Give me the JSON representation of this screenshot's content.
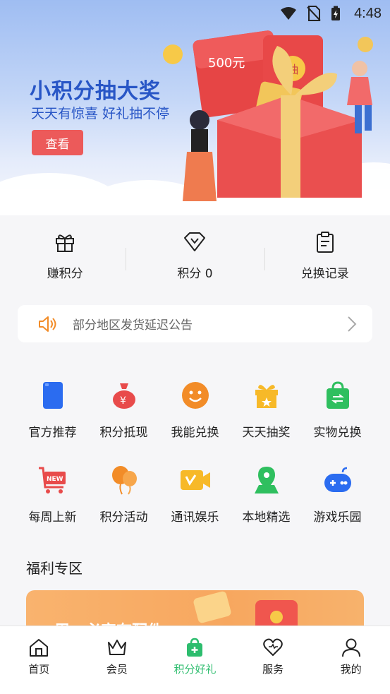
{
  "status_bar": {
    "time": "4:48"
  },
  "banner": {
    "title": "小积分抽大奖",
    "subtitle": "天天有惊喜 好礼抽不停",
    "button_label": "查看",
    "envelope_text": "500元",
    "envelope_badge": "抽"
  },
  "quick_actions": [
    {
      "label": "赚积分",
      "icon": "gift-icon"
    },
    {
      "label": "积分 0",
      "icon": "diamond-icon"
    },
    {
      "label": "兑换记录",
      "icon": "clipboard-icon"
    }
  ],
  "notice": {
    "text": "部分地区发货延迟公告"
  },
  "grid": {
    "row1": [
      {
        "label": "官方推荐",
        "icon": "phone-icon",
        "color": "#2b6cf0"
      },
      {
        "label": "积分抵现",
        "icon": "money-bag-icon",
        "color": "#e84b4b"
      },
      {
        "label": "我能兑换",
        "icon": "smile-icon",
        "color": "#f28c28"
      },
      {
        "label": "天天抽奖",
        "icon": "gift-box-icon",
        "color": "#f7b928"
      },
      {
        "label": "实物兑换",
        "icon": "shopping-bag-icon",
        "color": "#2fbf5f"
      }
    ],
    "row2": [
      {
        "label": "每周上新",
        "icon": "cart-new-icon",
        "color": "#e84b4b",
        "badge": "NEW"
      },
      {
        "label": "积分活动",
        "icon": "balloon-icon",
        "color": "#f28c28"
      },
      {
        "label": "通讯娱乐",
        "icon": "video-icon",
        "color": "#f7b928"
      },
      {
        "label": "本地精选",
        "icon": "map-pin-icon",
        "color": "#2fbf5f"
      },
      {
        "label": "游戏乐园",
        "icon": "gamepad-icon",
        "color": "#2b6cf0"
      }
    ]
  },
  "welfare": {
    "title": "福利专区",
    "card_text": "周一必定有配件"
  },
  "tabbar": [
    {
      "label": "首页",
      "icon": "home-icon",
      "active": false
    },
    {
      "label": "会员",
      "icon": "crown-icon",
      "active": false
    },
    {
      "label": "积分好礼",
      "icon": "gift-bag-icon",
      "active": true
    },
    {
      "label": "服务",
      "icon": "heart-icon",
      "active": false
    },
    {
      "label": "我的",
      "icon": "person-icon",
      "active": false
    }
  ],
  "colors": {
    "accent": "#2dbd6e",
    "banner_title": "#2856c6",
    "banner_button": "#ec5a5a"
  }
}
